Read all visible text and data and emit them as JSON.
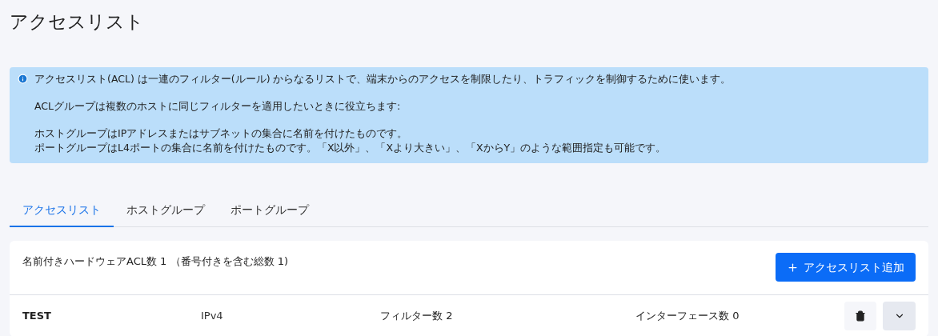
{
  "page": {
    "title": "アクセスリスト"
  },
  "info": {
    "paragraphs": [
      [
        "アクセスリスト(ACL) は一連のフィルター(ルール) からなるリストで、端末からのアクセスを制限したり、トラフィックを制御するために使います。"
      ],
      [
        "ACLグループは複数のホストに同じフィルターを適用したいときに役立ちます:"
      ],
      [
        "ホストグループはIPアドレスまたはサブネットの集合に名前を付けたものです。",
        "ポートグループはL4ポートの集合に名前を付けたものです。「X以外」、「Xより大きい」、「XからY」のような範囲指定も可能です。"
      ]
    ]
  },
  "tabs": [
    {
      "label": "アクセスリスト",
      "selected": true
    },
    {
      "label": "ホストグループ",
      "selected": false
    },
    {
      "label": "ポートグループ",
      "selected": false
    }
  ],
  "card": {
    "summary": "名前付きハードウェアACL数 1 （番号付きを含む総数 1)",
    "add_button": "アクセスリスト追加",
    "rows": [
      {
        "name": "TEST",
        "ip_version": "IPv4",
        "filters": "フィルター数 2",
        "interfaces": "インターフェース数 0",
        "expanded": false
      }
    ]
  }
}
